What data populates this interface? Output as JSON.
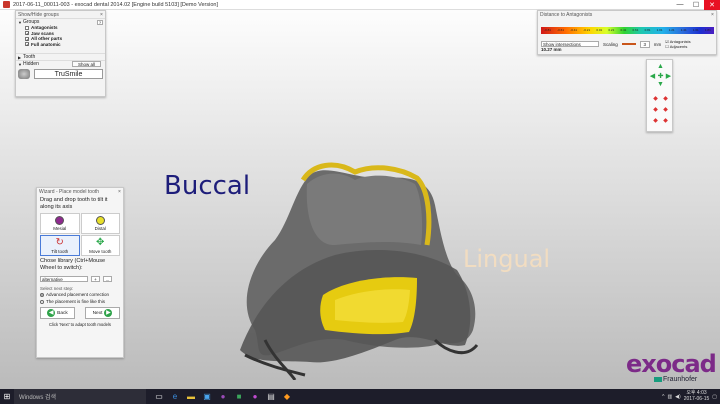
{
  "window": {
    "title": "2017-06-11_00011-003 - exocad dental 2014.02 [Engine build 5103] [Demo Version]",
    "controls": {
      "minimize": "—",
      "maximize": "☐",
      "close": "✕"
    }
  },
  "groups_panel": {
    "title": "Show/Hide groups",
    "close": "×",
    "groups_section": "Groups",
    "help": "?",
    "items": [
      {
        "label": "Antagonists",
        "checked": false
      },
      {
        "label": "Jaw scans",
        "checked": true
      },
      {
        "label": "All other parts",
        "checked": true
      },
      {
        "label": "Full anatomic",
        "checked": true
      }
    ],
    "tooth_section": "Tooth",
    "hidden_section": "Hidden",
    "show_all": "Show all",
    "trusmile": "TruSmile"
  },
  "distance_panel": {
    "title": "Distance to Antagonists",
    "close": "×",
    "scale_values": [
      "-0.81",
      "-0.61",
      "-0.41",
      "-0.21",
      "0.01",
      "0.21",
      "0.41",
      "0.61",
      "0.81",
      "1.01",
      "1.21",
      "1.41",
      "1.61",
      "1.81"
    ],
    "show_option": "Show intersections",
    "scaling_label": "Scaling",
    "scaling_value": "3",
    "unit": "mm",
    "opt_antagonists": "Antagonists",
    "opt_adjacents": "Adjacents",
    "distance_value": "10.27 mm"
  },
  "wizard": {
    "title": "Wizard - Place model tooth",
    "close": "×",
    "instruction": "Drag and drop tooth to tilt it along its axis",
    "buttons": [
      {
        "label": "Mesial",
        "color": "#8e2a8e"
      },
      {
        "label": "Distal",
        "color": "#e8e02a"
      },
      {
        "label": "Tilt tooth",
        "color": "tilt"
      },
      {
        "label": "Move tooth",
        "color": "move"
      }
    ],
    "library_text": "Chose library (Ctrl+Mouse Wheel to switch):",
    "library_value": "alternative",
    "library_plus": "+",
    "library_more": "...",
    "next_step_label": "Select next step:",
    "options": [
      {
        "label": "Advanced placement correction",
        "selected": true
      },
      {
        "label": "The placement is fine like this",
        "selected": false
      }
    ],
    "back": "Back",
    "next": "Next",
    "hint": "Click 'Next' to adapt tooth models"
  },
  "viewport": {
    "buccal": "Buccal",
    "lingual": "Lingual"
  },
  "logo": {
    "word": "exocad",
    "sub": "Fraunhofer",
    "colors": {
      "brand": "#7c2a88",
      "fraunhofer": "#179c7d"
    }
  },
  "taskbar": {
    "search": "Windows 검색",
    "tray_lang": "^",
    "time": "오후 4:03",
    "date": "2017-06-15"
  },
  "colors": {
    "buccal": "#1d1d7a",
    "lingual": "#f2ddc1",
    "crown_gold": "#e0c21a",
    "close": "#e81123"
  }
}
